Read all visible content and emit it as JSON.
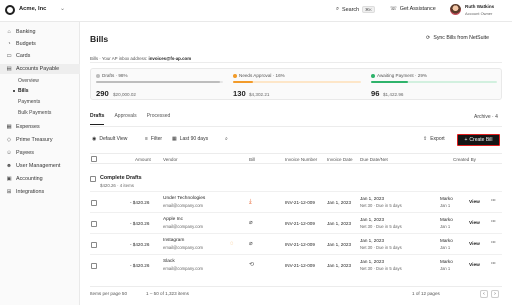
{
  "topbar": {
    "org_name": "Acme, Inc",
    "search_label": "Search",
    "search_shortcut": "⌘K",
    "assist_label": "Get Assistance",
    "user_name": "Ruth Watkins",
    "user_role": "Account Owner"
  },
  "sidebar": {
    "items": [
      {
        "label": "Banking",
        "icon": "bank-icon"
      },
      {
        "label": "Budgets",
        "icon": "budget-icon"
      },
      {
        "label": "Cards",
        "icon": "card-icon"
      },
      {
        "label": "Accounts Payable",
        "icon": "payable-icon"
      },
      {
        "label": "Expenses",
        "icon": "expense-icon"
      },
      {
        "label": "Prime Treasury",
        "icon": "treasury-icon"
      },
      {
        "label": "Payees",
        "icon": "payees-icon"
      },
      {
        "label": "User Management",
        "icon": "users-icon"
      },
      {
        "label": "Accounting",
        "icon": "accounting-icon"
      },
      {
        "label": "Integrations",
        "icon": "integrations-icon"
      }
    ],
    "subitems": [
      {
        "label": "Overview"
      },
      {
        "label": "Bills"
      },
      {
        "label": "Payments"
      },
      {
        "label": "Bulk Payments"
      }
    ]
  },
  "header": {
    "title": "Bills",
    "sync_label": "Sync Bills from NetSuite",
    "email_prefix": "Bills · Your AP inbox address:",
    "email_address": "invoices@fs-ap.com"
  },
  "stats": [
    {
      "label": "Drafts · 98%",
      "count": "290",
      "amount": "$20,000.02",
      "color": "#bdbdbd",
      "fill": 0.98
    },
    {
      "label": "Needs Approval · 16%",
      "count": "130",
      "amount": "$4,302.21",
      "color": "#f29b2a",
      "fill": 0.16
    },
    {
      "label": "Awaiting Payment · 29%",
      "count": "96",
      "amount": "$1,422.96",
      "color": "#2fb36b",
      "fill": 0.29
    }
  ],
  "tabs": [
    "Drafts",
    "Approvals",
    "Processed"
  ],
  "archive_label": "Archive · 4",
  "toolbar": {
    "default_view": "Default View",
    "filter": "Filter",
    "date_range": "Last 90 days",
    "export": "Export",
    "create": "Create Bill"
  },
  "table": {
    "headers": {
      "amount": "Amount",
      "vendor": "Vendor",
      "bill": "Bill",
      "invoice_number": "Invoice Number",
      "invoice_date": "Invoice Date",
      "due_date": "Due Date/Net",
      "created_by": "Created By"
    },
    "group": {
      "title": "Complete Drafts",
      "subtitle": "$420.26 · 4 items"
    },
    "rows": [
      {
        "amount": "- $420.26",
        "vendor": "Under Technologies",
        "email": "email@company.com",
        "bill_icon": "download-icon",
        "invoice": "INV-21-12-009",
        "invoice_date": "Jan 1, 2023",
        "due_date": "Jan 1, 2023",
        "due_net": "Net 30 · Due in 5 days",
        "created": "Marko",
        "created2": "Jan 1",
        "view": "View"
      },
      {
        "amount": "- $420.26",
        "vendor": "Apple Inc",
        "email": "email@company.com",
        "bill_icon": "attachment-icon",
        "invoice": "INV-21-12-009",
        "invoice_date": "Jan 1, 2023",
        "due_date": "Jan 1, 2023",
        "due_net": "Net 30 · Due in 5 days",
        "created": "Marko",
        "created2": "Jan 1",
        "view": "View"
      },
      {
        "amount": "- $420.26",
        "vendor": "Instagram",
        "email": "email@company.com",
        "bill_icon": "attachment-icon",
        "invoice": "INV-21-12-009",
        "invoice_date": "Jan 1, 2023",
        "due_date": "Jan 1, 2023",
        "due_net": "Net 30 · Due in 5 days",
        "created": "Marko",
        "created2": "Jan 1",
        "view": "View"
      },
      {
        "amount": "- $420.26",
        "vendor": "Slack",
        "email": "email@company.com",
        "bill_icon": "download-icon",
        "invoice": "INV-21-12-009",
        "invoice_date": "Jan 1, 2023",
        "due_date": "Jan 1, 2023",
        "due_net": "Net 30 · Due in 5 days",
        "created": "Marko",
        "created2": "Jan 1",
        "view": "View"
      }
    ]
  },
  "footer": {
    "per_page": "Items per page  50",
    "range": "1 – 50 of 1,323 items",
    "pages": "1 of 12 pages"
  }
}
